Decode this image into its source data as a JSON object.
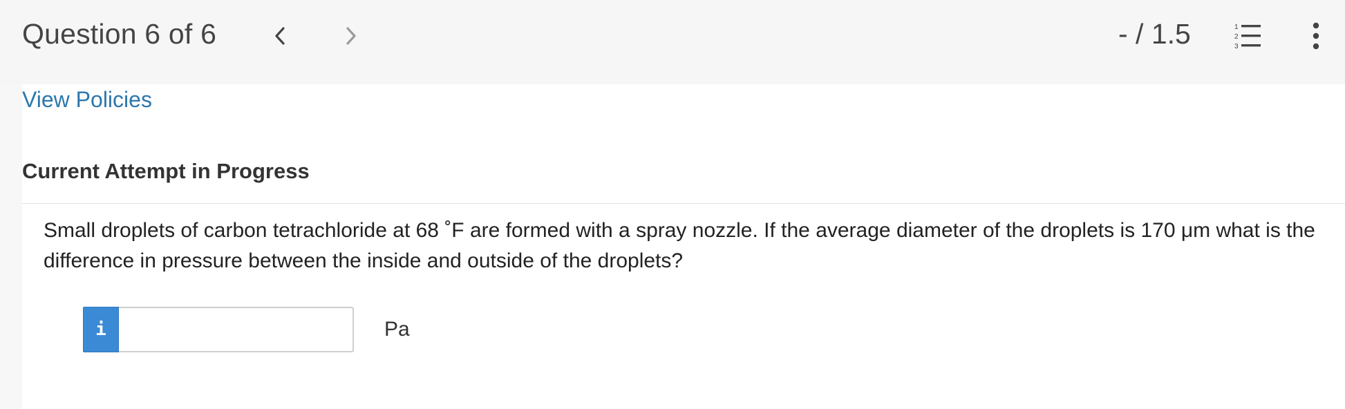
{
  "header": {
    "question_title": "Question 6 of 6",
    "score": "- / 1.5",
    "prev_icon": "chevron-left-icon",
    "next_icon": "chevron-right-icon",
    "list_icon": "numbered-list-icon",
    "more_icon": "more-vertical-icon",
    "list_numbers": [
      "1",
      "2",
      "3"
    ]
  },
  "policies": {
    "link_label": "View Policies"
  },
  "attempt": {
    "heading": "Current Attempt in Progress"
  },
  "question": {
    "text": "Small droplets of carbon tetrachloride at 68 ˚F are formed with a spray nozzle. If the average diameter of the droplets is 170 μm what is the difference in pressure between the inside and outside of the droplets?",
    "info_badge": "i",
    "answer_value": "",
    "unit": "Pa"
  },
  "colors": {
    "link": "#2c77ad",
    "info_badge": "#3b8ad6",
    "header_bg": "#f6f6f6"
  }
}
